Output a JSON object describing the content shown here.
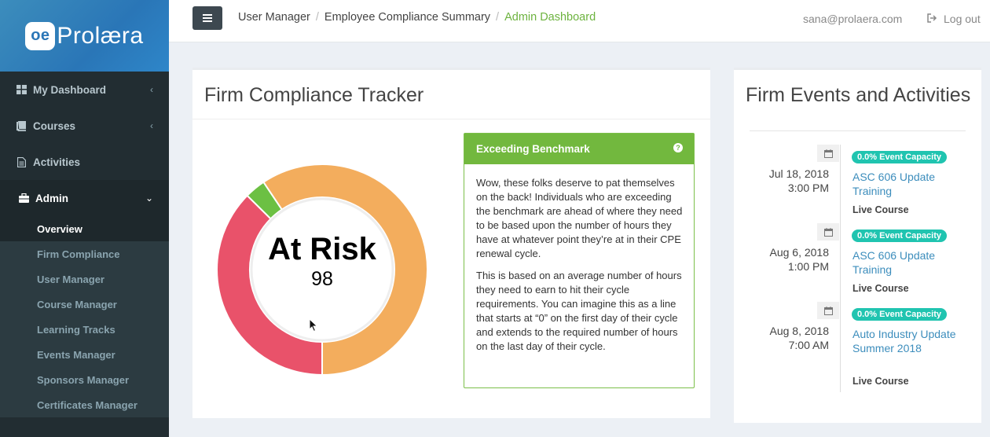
{
  "brand": {
    "logo_mark": "oe",
    "logo_text": "Prolæra"
  },
  "sidebar": {
    "items": [
      {
        "label": "My Dashboard",
        "icon": "dashboard-icon"
      },
      {
        "label": "Courses",
        "icon": "book-icon"
      },
      {
        "label": "Activities",
        "icon": "document-icon"
      },
      {
        "label": "Admin",
        "icon": "briefcase-icon"
      }
    ],
    "admin_submenu": [
      "Overview",
      "Firm Compliance",
      "User Manager",
      "Course Manager",
      "Learning Tracks",
      "Events Manager",
      "Sponsors Manager",
      "Certificates Manager"
    ]
  },
  "header": {
    "breadcrumbs": [
      "User Manager",
      "Employee Compliance Summary",
      "Admin Dashboard"
    ],
    "user_email": "sana@prolaera.com",
    "logout_label": "Log out"
  },
  "tracker": {
    "title": "Firm Compliance Tracker",
    "donut_label": "At Risk",
    "donut_value": "98",
    "segments": [
      {
        "name": "at-risk",
        "fraction": 0.374,
        "color": "#e9526a"
      },
      {
        "name": "benchmark",
        "fraction": 0.032,
        "color": "#6cc043"
      },
      {
        "name": "behind",
        "fraction": 0.594,
        "color": "#f3ad5d"
      }
    ],
    "info": {
      "heading": "Exceeding Benchmark",
      "p1": "Wow, these folks deserve to pat themselves on the back! Individuals who are exceeding the benchmark are ahead of where they need to be based upon the number of hours they have at whatever point they’re at in their CPE renewal cycle.",
      "p2": "This is based on an average number of hours they need to earn to hit their cycle requirements. You can imagine this as a line that starts at “0” on the first day of their cycle and extends to the required number of hours on the last day of their cycle."
    }
  },
  "events": {
    "title": "Firm Events and Activities",
    "items": [
      {
        "date": "Jul 18, 2018",
        "time": "3:00 PM",
        "badge": "0.0% Event Capacity",
        "title": "ASC 606 Update Training",
        "type": "Live Course"
      },
      {
        "date": "Aug 6, 2018",
        "time": "1:00 PM",
        "badge": "0.0% Event Capacity",
        "title": "ASC 606 Update Training",
        "type": "Live Course"
      },
      {
        "date": "Aug 8, 2018",
        "time": "7:00 AM",
        "badge": "0.0% Event Capacity",
        "title": "Auto Industry Update Summer 2018",
        "type": "Live Course"
      }
    ]
  }
}
